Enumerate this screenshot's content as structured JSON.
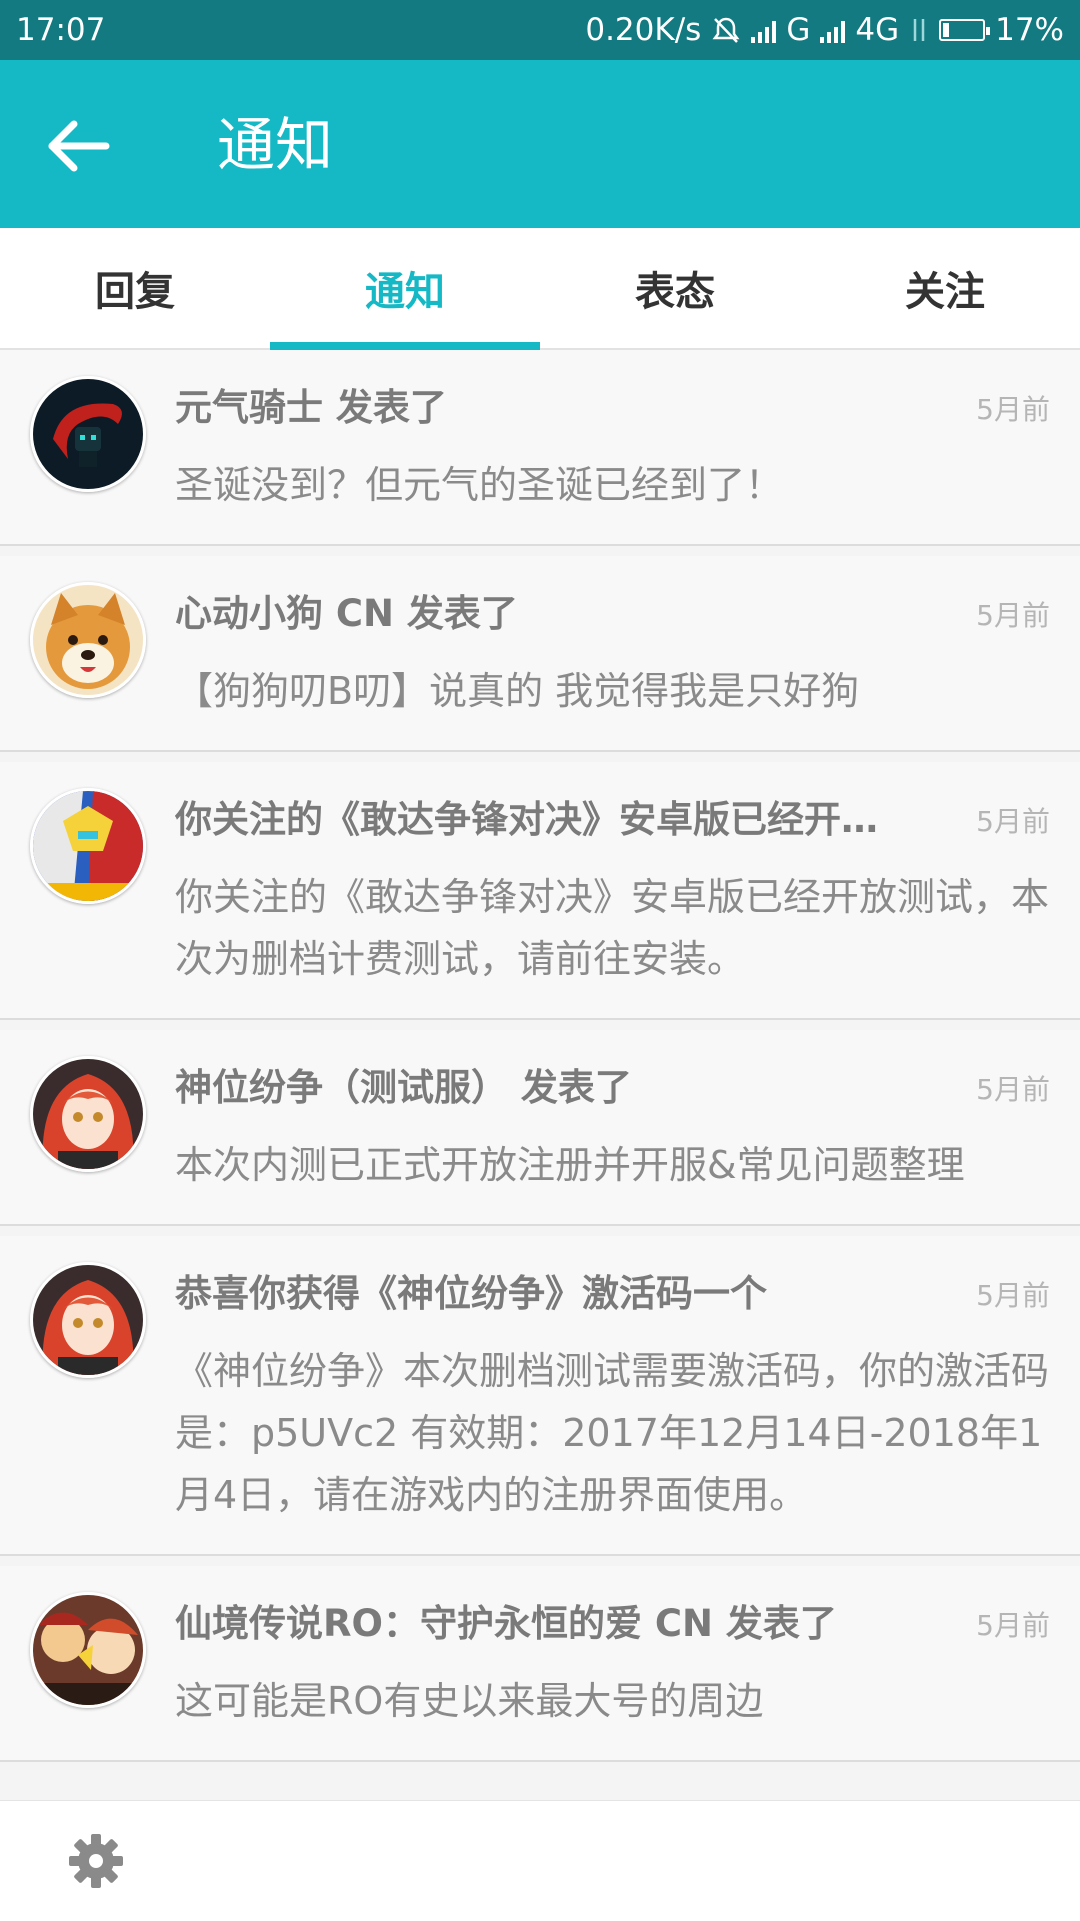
{
  "status_bar": {
    "time": "17:07",
    "net_speed": "0.20K/s",
    "signal1_label": "G",
    "signal2_label": "4G",
    "battery_percent": "17%",
    "battery_level": 0.17,
    "icons": [
      "mute-bell-icon",
      "signal-icon",
      "signal-icon",
      "data-transfer-icon",
      "battery-icon"
    ]
  },
  "app_bar": {
    "title": "通知",
    "back_icon": "arrow-left-icon"
  },
  "tabs": [
    {
      "label": "回复",
      "active": false
    },
    {
      "label": "通知",
      "active": true
    },
    {
      "label": "表态",
      "active": false
    },
    {
      "label": "关注",
      "active": false
    }
  ],
  "notifications": [
    {
      "title": "元气骑士 发表了",
      "time": "5月前",
      "body": "圣诞没到？但元气的圣诞已经到了！",
      "avatar": "soul-knight-avatar"
    },
    {
      "title": "心动小狗 CN 发表了",
      "time": "5月前",
      "body": "【狗狗叨B叨】说真的 我觉得我是只好狗",
      "avatar": "dog-avatar"
    },
    {
      "title": "你关注的《敢达争锋对决》安卓版已经开…",
      "time": "5月前",
      "body": "你关注的《敢达争锋对决》安卓版已经开放测试，本次为删档计费测试，请前往安装。",
      "avatar": "gundam-avatar"
    },
    {
      "title": "神位纷争（测试服） 发表了",
      "time": "5月前",
      "body": "本次内测已正式开放注册并开服&常见问题整理",
      "avatar": "red-hair-girl-avatar"
    },
    {
      "title": "恭喜你获得《神位纷争》激活码一个",
      "time": "5月前",
      "body": "《神位纷争》本次删档测试需要激活码，你的激活码是：p5UVc2 有效期：2017年12月14日-2018年1月4日，请在游戏内的注册界面使用。",
      "avatar": "red-hair-girl-avatar"
    },
    {
      "title": "仙境传说RO：守护永恒的爱 CN 发表了",
      "time": "5月前",
      "body": "这可能是RO有史以来最大号的周边",
      "avatar": "ro-avatar"
    }
  ],
  "bottom_bar": {
    "icon": "gear-icon"
  },
  "colors": {
    "accent": "#15b8c5",
    "status_bar": "#127a80",
    "list_bg": "#f8f8f8"
  }
}
